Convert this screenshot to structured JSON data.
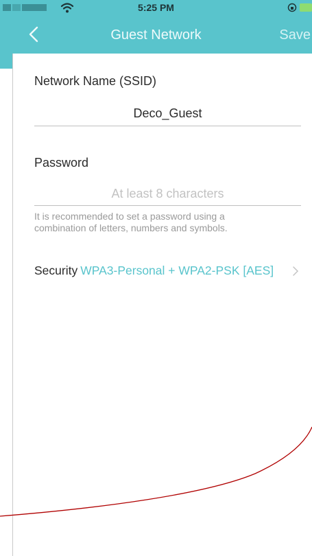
{
  "status_bar": {
    "time": "5:25 PM"
  },
  "header": {
    "title": "Guest Network",
    "save_label": "Save"
  },
  "form": {
    "ssid_label": "Network Name (SSID)",
    "ssid_value": "Deco_Guest",
    "password_label": "Password",
    "password_placeholder": "At least 8 characters",
    "password_hint_line1": "It is recommended to set a password using a",
    "password_hint_line2": "combination of letters, numbers and symbols.",
    "security_label": "Security",
    "security_value": "WPA3-Personal + WPA2-PSK [AES]"
  },
  "colors": {
    "accent": "#59c4cc",
    "annotation": "#b00000"
  }
}
